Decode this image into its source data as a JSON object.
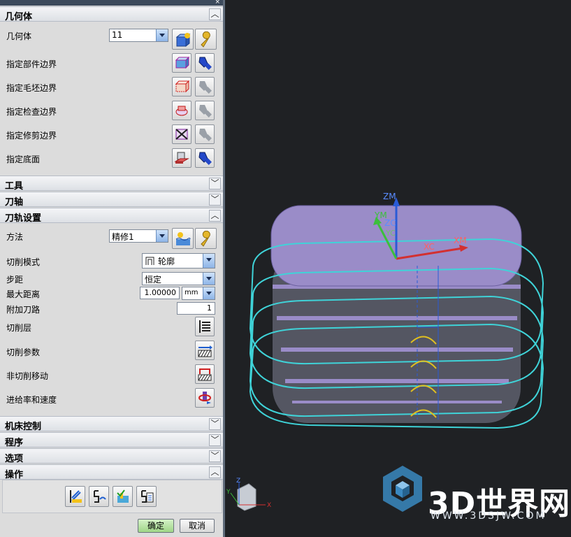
{
  "window": {
    "title_fragment": "",
    "close_glyph": "×"
  },
  "sections": {
    "geometry": {
      "label": "几何体",
      "expanded": true
    },
    "tool": {
      "label": "工具",
      "expanded": false
    },
    "tool_axis": {
      "label": "刀轴",
      "expanded": false
    },
    "path_settings": {
      "label": "刀轨设置",
      "expanded": true
    },
    "machine_control": {
      "label": "机床控制",
      "expanded": false
    },
    "program": {
      "label": "程序",
      "expanded": false
    },
    "options": {
      "label": "选项",
      "expanded": false
    },
    "operations": {
      "label": "操作",
      "expanded": true
    }
  },
  "geometry": {
    "geometry_label": "几何体",
    "geometry_value": "11",
    "part_boundary_label": "指定部件边界",
    "blank_boundary_label": "指定毛坯边界",
    "check_boundary_label": "指定检查边界",
    "trim_boundary_label": "指定修剪边界",
    "floor_label": "指定底面"
  },
  "path_settings": {
    "method_label": "方法",
    "method_value": "精修1",
    "cut_pattern_label": "切削模式",
    "cut_pattern_value": "轮廓",
    "stepover_label": "步距",
    "stepover_value": "恒定",
    "max_distance_label": "最大距离",
    "max_distance_value": "1.00000",
    "max_distance_unit": "mm",
    "additional_passes_label": "附加刀路",
    "additional_passes_value": "1",
    "cut_levels_label": "切削层",
    "cutting_params_label": "切削参数",
    "non_cutting_label": "非切削移动",
    "feeds_speeds_label": "进给率和速度"
  },
  "buttons": {
    "ok": "确定",
    "cancel": "取消"
  },
  "viewport": {
    "axis_labels": {
      "zm": "ZM",
      "ym": "YM",
      "xm": "XM",
      "zc": "ZC",
      "yc": "YC",
      "xc": "XC"
    },
    "triad_labels": {
      "z": "Z",
      "y": "Y",
      "x": "X"
    },
    "watermark": {
      "brand": "3D世界网",
      "url": "WWW.3DSJW.COM"
    }
  },
  "colors": {
    "part_top": "#9a8cc8",
    "part_side": "#5d5f6a",
    "toolpath": "#3fd3d8",
    "axis_x": "#d33030",
    "axis_y": "#3cbf3c",
    "axis_z": "#2a5bd6",
    "panel_bg": "#dcdcdc"
  }
}
